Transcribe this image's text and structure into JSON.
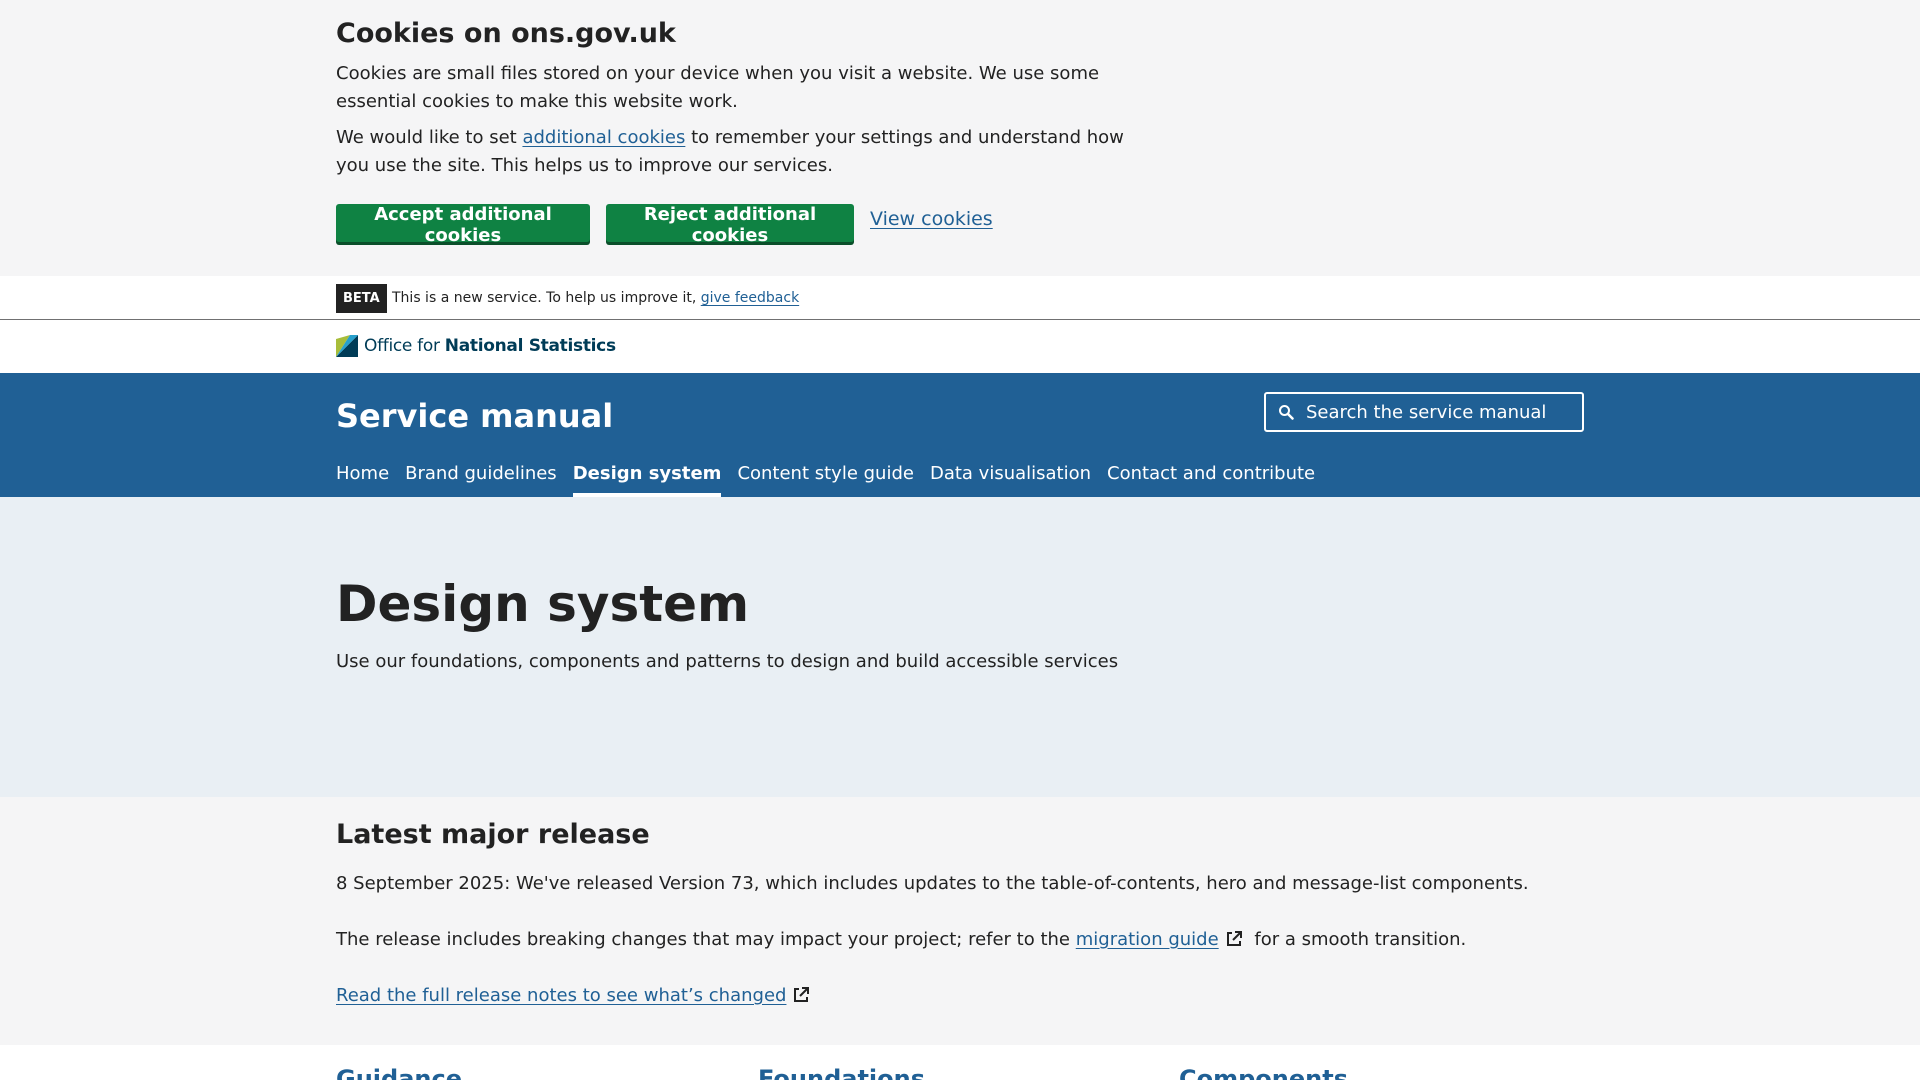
{
  "cookies": {
    "title": "Cookies on ons.gov.uk",
    "p1": "Cookies are small files stored on your device when you visit a website. We use some essential cookies to make this website work.",
    "p2_before": "We would like to set ",
    "p2_link": "additional cookies",
    "p2_after": " to remember your settings and understand how you use the site. This helps us to improve our services.",
    "accept_label": "Accept additional cookies",
    "reject_label": "Reject additional cookies",
    "view_label": "View cookies"
  },
  "beta": {
    "badge": "BETA",
    "message": "This is a new service. To help us improve it, ",
    "feedback_link": "give feedback"
  },
  "logo": {
    "text_prefix": "Office for ",
    "text_bold": "National Statistics"
  },
  "header": {
    "title": "Service manual",
    "search_placeholder": "Search the service manual",
    "nav": [
      {
        "label": "Home",
        "active": false
      },
      {
        "label": "Brand guidelines",
        "active": false
      },
      {
        "label": "Design system",
        "active": true
      },
      {
        "label": "Content style guide",
        "active": false
      },
      {
        "label": "Data visualisation",
        "active": false
      },
      {
        "label": "Contact and contribute",
        "active": false
      }
    ]
  },
  "hero": {
    "title": "Design system",
    "subtitle": "Use our foundations, components and patterns to design and build accessible services"
  },
  "release": {
    "title": "Latest major release",
    "line1": "8 September 2025: We've released Version 73, which includes updates to the table-of-contents, hero and message-list components.",
    "line2_before": "The release includes breaking changes that may impact your project; refer to the ",
    "line2_link": "migration guide",
    "line2_after": " for a smooth transition.",
    "notes_link": "Read the full release notes to see what’s changed"
  },
  "sections": {
    "guidance": "Guidance",
    "foundations": "Foundations",
    "components": "Components"
  },
  "colors": {
    "ons_blue": "#206095",
    "button_green": "#0f8243",
    "hero_bg": "#e9eff4",
    "grey_bg": "#f5f5f6"
  },
  "icons": {
    "search": "search-icon",
    "external": "external-link-icon",
    "logo": "ons-logo-icon"
  }
}
